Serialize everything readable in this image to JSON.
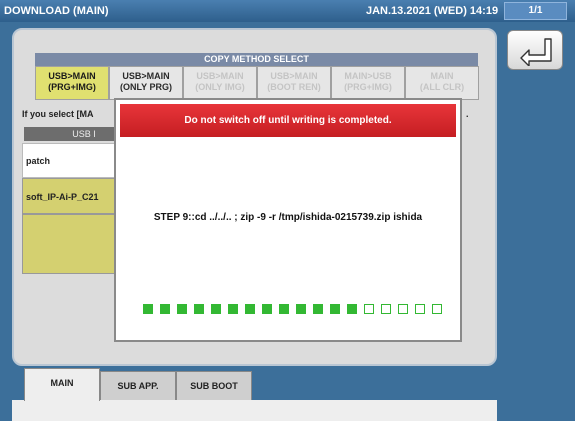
{
  "titlebar": {
    "title": "DOWNLOAD (MAIN)",
    "datetime": "JAN.13.2021 (WED) 14:19",
    "page_indicator": "1/1"
  },
  "copy_method": {
    "header": "COPY METHOD SELECT",
    "tabs": [
      {
        "line1": "USB>MAIN",
        "line2": "(PRG+IMG)",
        "state": "active"
      },
      {
        "line1": "USB>MAIN",
        "line2": "(ONLY PRG)",
        "state": "normal"
      },
      {
        "line1": "USB>MAIN",
        "line2": "(ONLY IMG)",
        "state": "disabled"
      },
      {
        "line1": "USB>MAIN",
        "line2": "(BOOT REN)",
        "state": "disabled"
      },
      {
        "line1": "MAIN>USB",
        "line2": "(PRG+IMG)",
        "state": "disabled"
      },
      {
        "line1": "MAIN",
        "line2": "(ALL CLR)",
        "state": "disabled"
      }
    ]
  },
  "info_text": "If you select [MA",
  "info_tail": ".",
  "usb_list": {
    "header": "USB I",
    "rows": [
      "patch",
      "soft_IP-Ai-P_C21"
    ]
  },
  "bottom_tabs": [
    "MAIN",
    "SUB APP.",
    "SUB BOOT"
  ],
  "dialog": {
    "warning": "Do not switch off until writing is completed.",
    "message": "STEP 9::cd ../../.. ; zip -9 -r /tmp/ishida-0215739.zip ishida",
    "progress_filled": 13,
    "progress_total": 18
  },
  "colors": {
    "progress_green": "#33b833",
    "banner_red": "#d9282c",
    "active_yellow": "#e0e070"
  }
}
